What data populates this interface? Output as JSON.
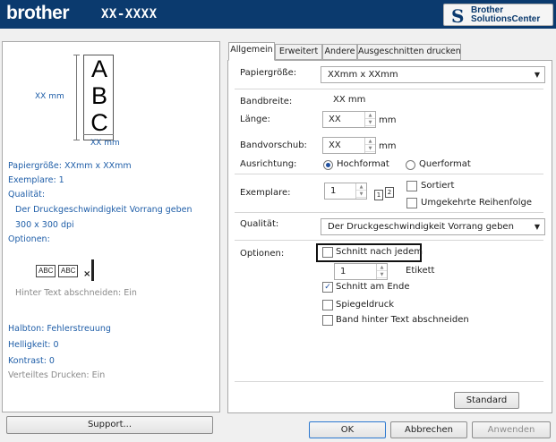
{
  "header": {
    "logo": "brother",
    "model": "XX-XXXX",
    "solutions_center": {
      "line1": "Brother",
      "line2": "SolutionsCenter"
    }
  },
  "preview": {
    "letters": [
      "A",
      "B",
      "C"
    ],
    "height_label": "XX mm",
    "width_label": "XX mm"
  },
  "summary": {
    "paper_size": "Papiergröße: XXmm x XXmm",
    "copies": "Exemplare: 1",
    "quality_label": "Qualität:",
    "quality_value": "Der Druckgeschwindigkeit Vorrang geben",
    "resolution": "300 x 300 dpi",
    "options_label": "Optionen:",
    "abc_label": "ABC",
    "cut_text": "Hinter Text abschneiden: Ein",
    "halftone": "Halbton: Fehlerstreuung",
    "brightness": "Helligkeit:  0",
    "contrast": "Kontrast:  0",
    "distributed": "Verteiltes Drucken: Ein"
  },
  "support_button": "Support...",
  "tabs": [
    "Allgemein",
    "Erweitert",
    "Andere",
    "Ausgeschnitten drucken"
  ],
  "form": {
    "paper_size_label": "Papiergröße:",
    "paper_size_value": "XXmm x XXmm",
    "tape_width_label": "Bandbreite:",
    "tape_width_value": "XX mm",
    "length_label": "Länge:",
    "length_value": "XX",
    "length_unit": "mm",
    "feed_label": "Bandvorschub:",
    "feed_value": "XX",
    "feed_unit": "mm",
    "orientation_label": "Ausrichtung:",
    "portrait": "Hochformat",
    "landscape": "Querformat",
    "copies_label": "Exemplare:",
    "copies_value": "1",
    "collate": "Sortiert",
    "reverse_order": "Umgekehrte Reihenfolge",
    "quality_label": "Qualität:",
    "quality_value": "Der Druckgeschwindigkeit Vorrang geben",
    "options_label": "Optionen:",
    "cut_every": "Schnitt nach jedem",
    "cut_every_value": "1",
    "cut_every_unit": "Etikett",
    "cut_at_end": "Schnitt am Ende",
    "mirror": "Spiegeldruck",
    "cut_after_text": "Band hinter Text abschneiden",
    "collate_icon": {
      "a": "1",
      "b": "2"
    }
  },
  "buttons": {
    "default": "Standard",
    "ok": "OK",
    "cancel": "Abbrechen",
    "apply": "Anwenden"
  }
}
